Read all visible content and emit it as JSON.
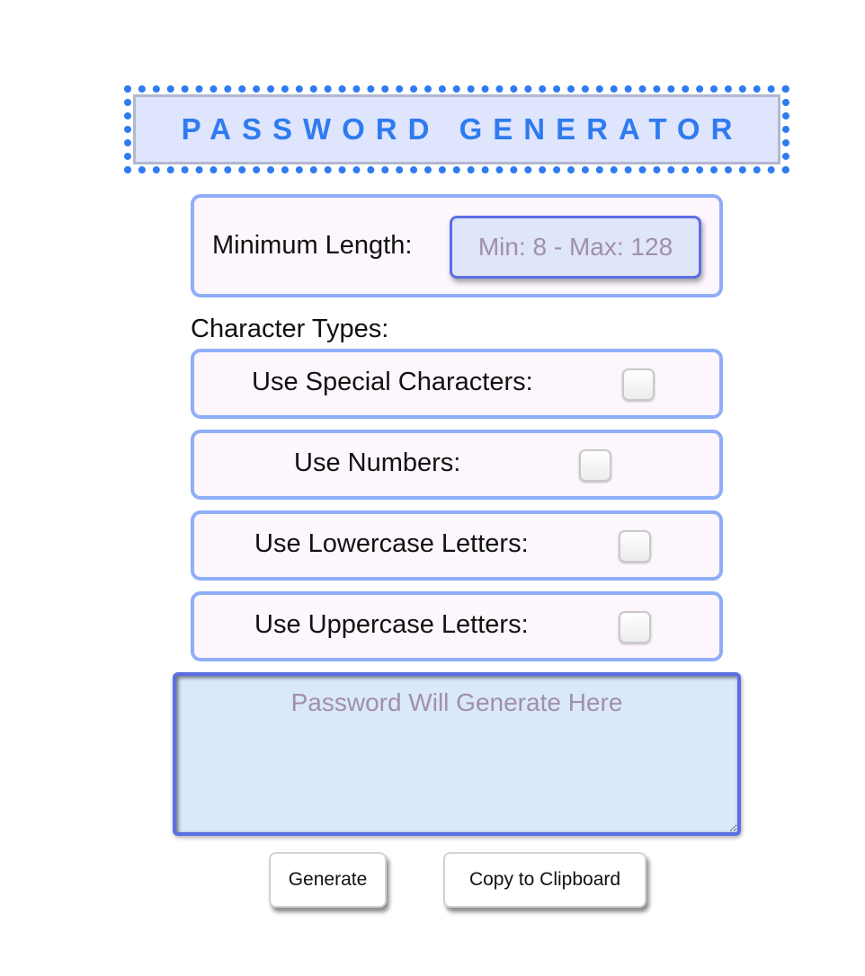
{
  "header": {
    "title": "PASSWORD GENERATOR"
  },
  "length": {
    "label": "Minimum Length:",
    "placeholder": "Min: 8 - Max: 128",
    "value": ""
  },
  "character_types": {
    "heading": "Character Types:",
    "options": [
      {
        "label": "Use Special Characters:",
        "checked": false
      },
      {
        "label": "Use Numbers:",
        "checked": false
      },
      {
        "label": "Use Lowercase Letters:",
        "checked": false
      },
      {
        "label": "Use Uppercase Letters:",
        "checked": false
      }
    ]
  },
  "output": {
    "placeholder": "Password Will Generate Here",
    "value": ""
  },
  "buttons": {
    "generate_label": "Generate",
    "copy_label": "Copy to Clipboard"
  },
  "colors": {
    "accent": "#2f7bf0",
    "panel_border": "#8eaef8",
    "panel_bg": "#fdf6fd",
    "input_border": "#5b6fe4",
    "output_bg": "#dae8fc",
    "title_bg": "#dee5fd"
  }
}
